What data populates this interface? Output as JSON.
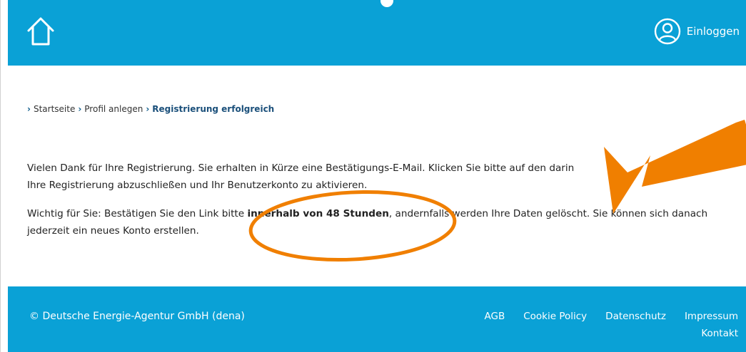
{
  "header": {
    "home_icon": "home-icon",
    "login_icon": "user-circle-icon",
    "login_label": "Einloggen",
    "bg_color": "#0aa1d6"
  },
  "breadcrumb": {
    "items": [
      "Startseite",
      "Profil anlegen"
    ],
    "current": "Registrierung erfolgreich"
  },
  "content": {
    "paragraph1_line1": "Vielen Dank für Ihre Registrierung. Sie erhalten in Kürze eine Bestätigungs-E-Mail. Klicken Sie bitte auf den darin",
    "paragraph1_line2": "Ihre Registrierung abzuschließen und Ihr Benutzerkonto zu aktivieren.",
    "paragraph2_before": "Wichtig für Sie: Bestätigen Sie den Link bitte ",
    "paragraph2_bold": "innerhalb von 48 Stunden",
    "paragraph2_after": ", andernfalls werden Ihre Daten gelöscht. Sie können sich danach jederzeit ein neues Konto erstellen."
  },
  "footer": {
    "copyright": "© Deutsche Energie-Agentur GmbH (dena)",
    "links": [
      "AGB",
      "Cookie Policy",
      "Datenschutz",
      "Impressum"
    ],
    "second_row_link": "Kontakt"
  },
  "annotation": {
    "color": "#f07f00",
    "shapes": [
      "highlight-ellipse",
      "pointer-arrow"
    ]
  }
}
